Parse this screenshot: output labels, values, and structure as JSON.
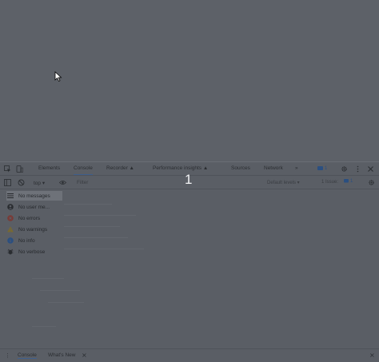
{
  "devtools": {
    "tabs": [
      {
        "label": "Elements"
      },
      {
        "label": "Console"
      },
      {
        "label": "Recorder ▲"
      },
      {
        "label": "Performance insights ▲"
      },
      {
        "label": "Sources"
      },
      {
        "label": "Network"
      },
      {
        "label": "»"
      }
    ],
    "badge_count": "1",
    "console_toolbar": {
      "context": "top ▾",
      "filter_placeholder": "Filter",
      "levels": "Default levels ▾",
      "issues_text": "1 Issue:",
      "issues_count": "1"
    },
    "overlay_number": "1",
    "sidebar": [
      {
        "label": "No messages",
        "icon": "list-icon"
      },
      {
        "label": "No user me...",
        "icon": "user-icon"
      },
      {
        "label": "No errors",
        "icon": "error-icon"
      },
      {
        "label": "No warnings",
        "icon": "warning-icon"
      },
      {
        "label": "No info",
        "icon": "info-icon"
      },
      {
        "label": "No verbose",
        "icon": "bug-icon"
      }
    ],
    "drawer": {
      "tabs": [
        {
          "label": "Console"
        },
        {
          "label": "What's New"
        }
      ]
    },
    "colors": {
      "background": "#5c6067",
      "accent": "#3f5f8c"
    }
  }
}
